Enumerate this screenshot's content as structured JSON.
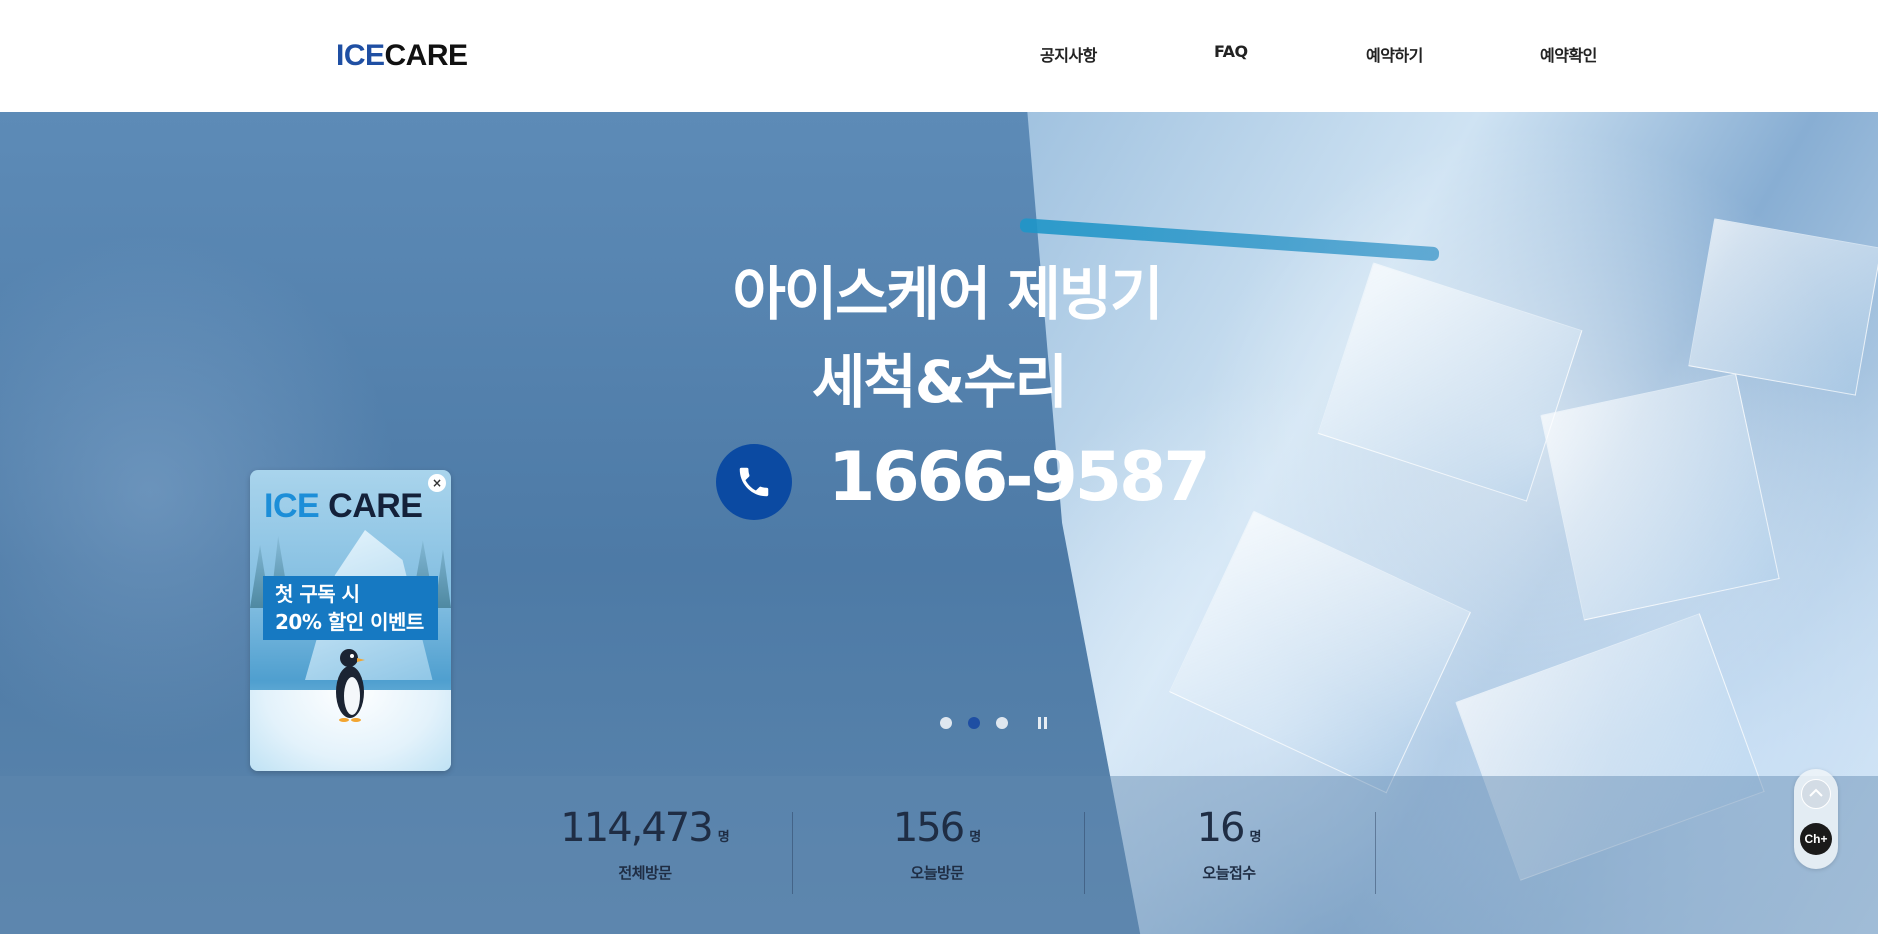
{
  "header": {
    "logo_ice": "ICE",
    "logo_care": "CARE",
    "nav": [
      "공지사항",
      "FAQ",
      "예약하기",
      "예약확인"
    ]
  },
  "hero": {
    "title_line1": "아이스케어 제빙기",
    "title_line2": "세척&수리",
    "phone_number": "1666-9587",
    "phone_icon": "phone-icon",
    "slider": {
      "total": 3,
      "active_index": 2,
      "control": "pause"
    }
  },
  "stats": [
    {
      "value": "114,473",
      "unit": "명",
      "label": "전체방문"
    },
    {
      "value": "156",
      "unit": "명",
      "label": "오늘방문"
    },
    {
      "value": "16",
      "unit": "명",
      "label": "오늘접수"
    }
  ],
  "popup": {
    "brand_ice": "ICE",
    "brand_care": "CARE",
    "close_label": "×",
    "banner_line1": "첫 구독 시",
    "banner_line2": "20% 할인 이벤트"
  },
  "side": {
    "top_icon": "chevron-up-icon",
    "channel_label": "Ch+"
  },
  "colors": {
    "brand_blue": "#1f4fa3",
    "phone_circle": "#0b4aa2",
    "popup_banner": "#1679c2"
  }
}
